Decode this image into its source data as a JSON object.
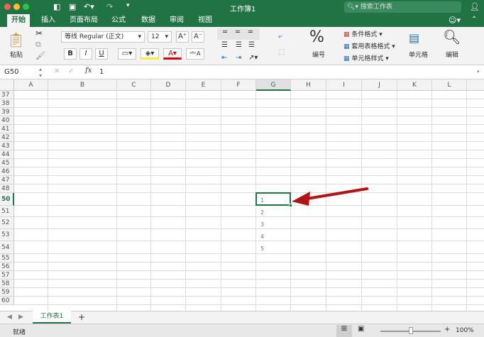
{
  "title": "工作簿1",
  "search_placeholder": "搜索工作表",
  "tabs": [
    "开始",
    "插入",
    "页面布局",
    "公式",
    "数据",
    "审阅",
    "视图"
  ],
  "ribbon": {
    "paste": "粘贴",
    "font": "等线 Regular (正文)",
    "size": "12",
    "bold": "B",
    "italic": "I",
    "underline": "U",
    "number": "编号",
    "cond_format": "条件格式",
    "table_format": "套用表格格式",
    "cell_style": "单元格样式",
    "cells": "单元格",
    "edit": "编辑",
    "percent": "%"
  },
  "formula": {
    "name_box": "G50",
    "fx": "fx",
    "value": "1"
  },
  "columns": [
    "A",
    "B",
    "C",
    "D",
    "E",
    "F",
    "G",
    "H",
    "I",
    "J",
    "K",
    "L"
  ],
  "rows": [
    "37",
    "38",
    "39",
    "40",
    "41",
    "42",
    "43",
    "44",
    "45",
    "46",
    "47",
    "48",
    "50",
    "51",
    "52",
    "53",
    "54",
    "55",
    "56",
    "57",
    "58",
    "59",
    "60"
  ],
  "selected_cell": "G50",
  "cells": {
    "G50": "1",
    "G51": "2",
    "G52": "3",
    "G53": "4",
    "G54": "5"
  },
  "sheet_tab": "工作表1",
  "add_sheet": "+",
  "status": "就绪",
  "zoom": "100%",
  "accent": "#217346",
  "arrow_color": "#b01515"
}
